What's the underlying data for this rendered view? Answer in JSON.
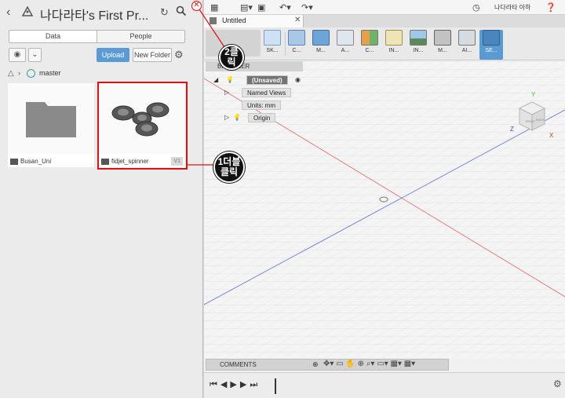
{
  "data_panel": {
    "title": "나다라타's First Pr...",
    "tabs": [
      "Data",
      "People"
    ],
    "upload_label": "Upload",
    "new_folder_label": "New Folder",
    "branch": "master",
    "items": [
      {
        "name": "Busan_Uni",
        "type": "folder"
      },
      {
        "name": "fidjet_spinner",
        "type": "design",
        "version": "V1"
      }
    ]
  },
  "app": {
    "user": "나다라타 아하",
    "doc_tab": "Untitled",
    "ribbon": [
      {
        "label": "SK..."
      },
      {
        "label": "C..."
      },
      {
        "label": "M..."
      },
      {
        "label": "A..."
      },
      {
        "label": "C..."
      },
      {
        "label": "IN..."
      },
      {
        "label": "IN..."
      },
      {
        "label": "M..."
      },
      {
        "label": "AI..."
      },
      {
        "label": "SE..."
      }
    ],
    "browser": {
      "header": "BROWSER",
      "root": "(Unsaved)",
      "rows": [
        "Named Views",
        "Units: mm",
        "Origin"
      ]
    },
    "viewcube": {
      "front": "FRONT",
      "right": "RIGHT",
      "x": "X",
      "y": "Y",
      "z": "Z"
    },
    "comments_label": "COMMENTS",
    "accent": "#5b9bd5",
    "highlight": "#dd1111"
  },
  "annotations": {
    "step1": "1더블\n클릭",
    "step2": "2클릭"
  }
}
